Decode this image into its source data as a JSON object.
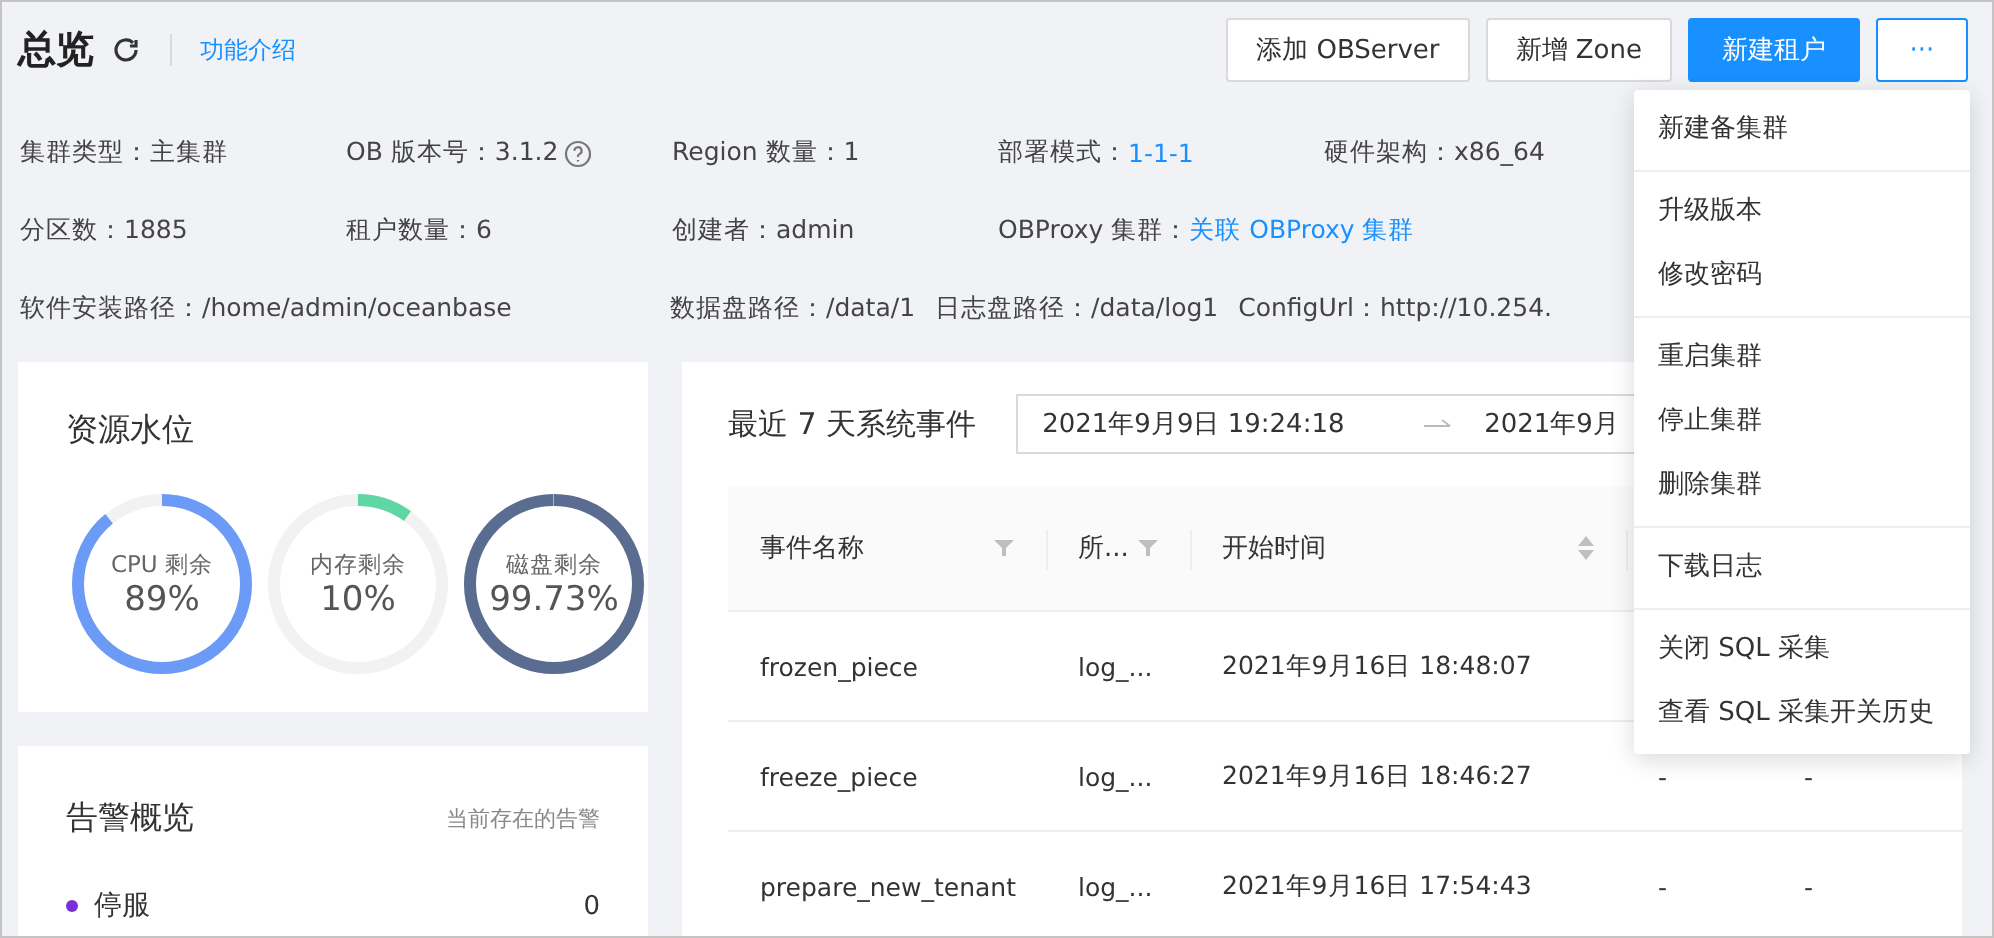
{
  "header": {
    "title": "总览",
    "intro_link": "功能介绍",
    "buttons": [
      {
        "label": "添加 OBServer",
        "kind": "default"
      },
      {
        "label": "新增 Zone",
        "kind": "default"
      },
      {
        "label": "新建租户",
        "kind": "primary"
      },
      {
        "label": "···",
        "kind": "more"
      }
    ]
  },
  "info_rows": [
    [
      {
        "label": "集群类型：",
        "value": "主集群"
      },
      {
        "label": "OB 版本号：",
        "value": "3.1.2",
        "help": true
      },
      {
        "label": "Region 数量：",
        "value": "1"
      },
      {
        "label": "部署模式：",
        "value": "1-1-1",
        "link": true
      },
      {
        "label": "硬件架构：",
        "value": "x86_64"
      }
    ],
    [
      {
        "label": "分区数：",
        "value": "1885"
      },
      {
        "label": "租户数量：",
        "value": "6"
      },
      {
        "label": "创建者：",
        "value": "admin"
      },
      {
        "label": "OBProxy 集群：",
        "value": "关联 OBProxy 集群",
        "link": true
      }
    ],
    [
      {
        "label": "软件安装路径：",
        "value": "/home/admin/oceanbase"
      },
      {
        "label": "数据盘路径：",
        "value": "/data/1"
      },
      {
        "label": "日志盘路径：",
        "value": "/data/log1"
      },
      {
        "label": "ConfigUrl：",
        "value": "http://10.254."
      }
    ]
  ],
  "resources": {
    "title": "资源水位",
    "gauges": [
      {
        "label": "CPU 剩余",
        "reading": "89%",
        "level": 0.89,
        "color": "#6b9bf7"
      },
      {
        "label": "内存剩余",
        "reading": "10%",
        "level": 0.1,
        "color": "#5fd6a4"
      },
      {
        "label": "磁盘剩余",
        "reading": "99.73%",
        "level": 0.9973,
        "color": "#5a6c8f"
      }
    ]
  },
  "alarms": {
    "title": "告警概览",
    "subtitle": "当前存在的告警",
    "items": [
      {
        "label": "停服",
        "count": "0",
        "color": "#7b2fd6"
      }
    ]
  },
  "events": {
    "title": "最近 7 天系统事件",
    "range_start": "2021年9月9日 19:24:18",
    "range_end": "2021年9月",
    "columns": [
      {
        "label": "事件名称",
        "filter": true
      },
      {
        "label": "所...",
        "filter": true
      },
      {
        "label": "开始时间",
        "sort": true
      },
      {},
      {}
    ],
    "rows": [
      [
        "frozen_piece",
        "log_...",
        "2021年9月16日 18:48:07"
      ],
      [
        "freeze_piece",
        "log_...",
        "2021年9月16日 18:46:27",
        "-",
        "-"
      ],
      [
        "prepare_new_tenant",
        "log_...",
        "2021年9月16日 17:54:43",
        "-",
        "-"
      ]
    ]
  },
  "menu": {
    "groups": [
      [
        {
          "label": "新建备集群"
        }
      ],
      [
        {
          "label": "升级版本"
        },
        {
          "label": "修改密码"
        }
      ],
      [
        {
          "label": "重启集群"
        },
        {
          "label": "停止集群"
        },
        {
          "label": "删除集群"
        }
      ],
      [
        {
          "label": "下载日志"
        }
      ],
      [
        {
          "label": "关闭 SQL 采集"
        },
        {
          "label": "查看 SQL 采集开关历史"
        }
      ]
    ]
  }
}
